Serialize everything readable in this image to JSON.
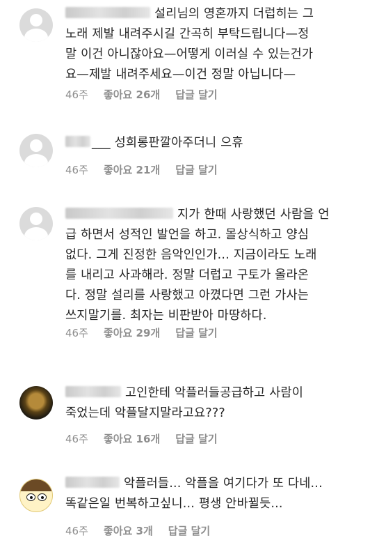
{
  "comments": [
    {
      "lines": [
        "설리님의 영혼까지 더럽히는 그",
        "노래 제발 내려주시길 간곡히 부탁드립니다—정",
        "말 이건 아니잖아요—어떻게 이러실 수 있는건가",
        "요—제발 내려주세요—이건 정말 아닙니다—"
      ],
      "time": "46주",
      "likes": "좋아요 26개",
      "reply": "답글 달기"
    },
    {
      "lines": [
        "___ 성희롱판깔아주더니 으휴"
      ],
      "time": "46주",
      "likes": "좋아요 21개",
      "reply": "답글 달기"
    },
    {
      "lines": [
        "지가 한때 사랑했던 사람을 언",
        "급 하면서 성적인 발언을 하고. 몰상식하고 양심",
        "없다. 그게 진정한 음악인인가... 지금이라도 노래",
        "를 내리고 사과해라. 정말 더럽고 구토가 올라온",
        "다. 정말 설리를 사랑했고 아꼈다면 그런 가사는",
        "쓰지말기를.  최자는 비판받아 마땅하다."
      ],
      "time": "46주",
      "likes": "좋아요 29개",
      "reply": "답글 달기"
    },
    {
      "lines": [
        "고인한테 악플러들공급하고  사람이",
        "죽었는데  악플달지말라고요???"
      ],
      "time": "46주",
      "likes": "좋아요 16개",
      "reply": "답글 달기"
    },
    {
      "lines": [
        "악플러들... 악플을 여기다가 또 다네...",
        "똑같은일 번복하고싶니... 평생 안바뀔듯..."
      ],
      "time": "46주",
      "likes": "좋아요 3개",
      "reply": "답글 달기"
    }
  ]
}
